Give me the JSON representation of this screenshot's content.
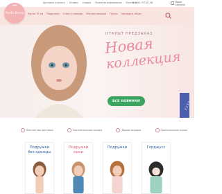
{
  "topbar": {
    "links": [
      "Доставка и оплата",
      "Отзывы",
      "Скидки",
      "Полезная информация",
      "Контакты"
    ],
    "phone": "8 (800) 707-61-46",
    "lang": "",
    "cart_label": "Ваша корзина"
  },
  "logo": {
    "text": "Paola Reina"
  },
  "nav": {
    "items": [
      "Куклы 32 см",
      "Подружки",
      "Стиль и наряды",
      "Мягкие малыши",
      "Пупсы",
      "Одежда и обувь"
    ]
  },
  "hero": {
    "subtitle": "ОТКРЫТ ПРЕДЗАКАЗ",
    "title_line1": "Новая",
    "title_line2": "коллекция",
    "cta_label": "ВСЕ НОВИНКИ",
    "badge_text": "2 2 5 5"
  },
  "features": [
    {
      "icon": "truck-icon",
      "label": "Бесплатная доставка"
    },
    {
      "icon": "percent-icon",
      "label": "Накопительные скидки"
    },
    {
      "icon": "gift-icon",
      "label": "Дарим подарки"
    },
    {
      "icon": "heart-icon",
      "label": "Оригинальные куклы"
    }
  ],
  "cards": [
    {
      "title_line1": "Подружки",
      "title_line2": "без одежды"
    },
    {
      "title_line1": "Подружки",
      "title_line2": "мини"
    },
    {
      "title_line1": "Подружки",
      "title_line2": ""
    },
    {
      "title_line1": "Горджусс",
      "title_line2": ""
    }
  ],
  "colors": {
    "accent_pink": "#e98a9c",
    "nav_bg": "#f9e5e0",
    "cta_green": "#3aa55f",
    "card_blue": "#2d5d9f",
    "badge_blue": "#4d5fae"
  }
}
